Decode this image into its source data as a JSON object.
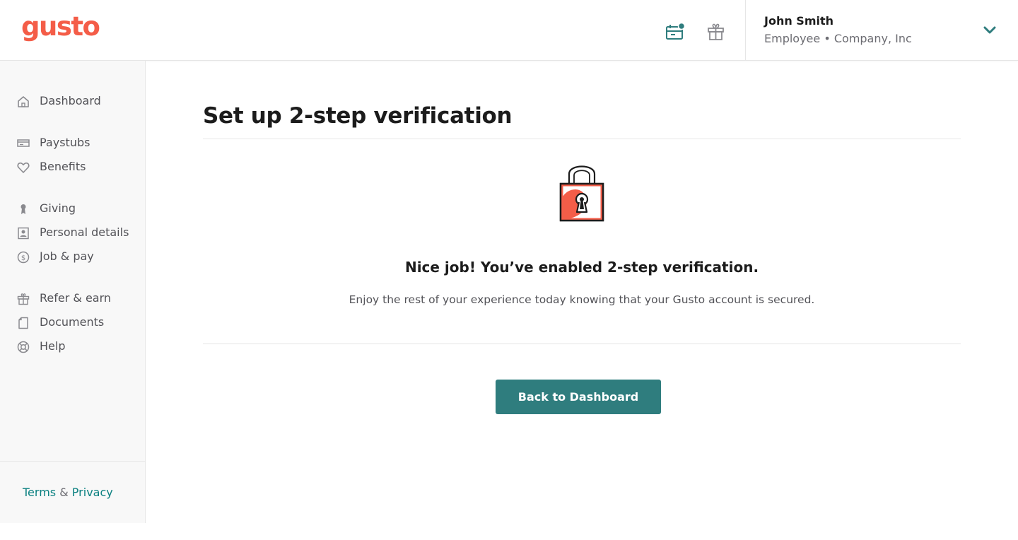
{
  "brand": {
    "logo_text": "gusto",
    "accent": "#f45d48",
    "primary": "#2f7d7e",
    "link": "#0a8080"
  },
  "header": {
    "icons": [
      "calendar-icon",
      "gift-icon"
    ],
    "account": {
      "name": "John Smith",
      "role": "Employee • Company, Inc",
      "menu_icon": "chevron-down-icon"
    }
  },
  "sidebar": {
    "items": [
      {
        "label": "Dashboard",
        "icon": "home-icon"
      },
      {
        "label": "Paystubs",
        "icon": "paystub-icon"
      },
      {
        "label": "Benefits",
        "icon": "heart-icon"
      },
      {
        "label": "Giving",
        "icon": "giving-icon"
      },
      {
        "label": "Personal details",
        "icon": "person-card-icon"
      },
      {
        "label": "Job & pay",
        "icon": "dollar-icon"
      },
      {
        "label": "Refer & earn",
        "icon": "gift-icon"
      },
      {
        "label": "Documents",
        "icon": "document-icon"
      },
      {
        "label": "Help",
        "icon": "lifebuoy-icon"
      }
    ],
    "footer": {
      "terms": "Terms",
      "ampersand": "&",
      "privacy": "Privacy"
    }
  },
  "main": {
    "title": "Set up 2-step verification",
    "illustration": "padlock-icon",
    "headline": "Nice job! You’ve enabled 2-step verification.",
    "subtext": "Enjoy the rest of your experience today knowing that your Gusto account is secured.",
    "button_label": "Back to Dashboard"
  }
}
